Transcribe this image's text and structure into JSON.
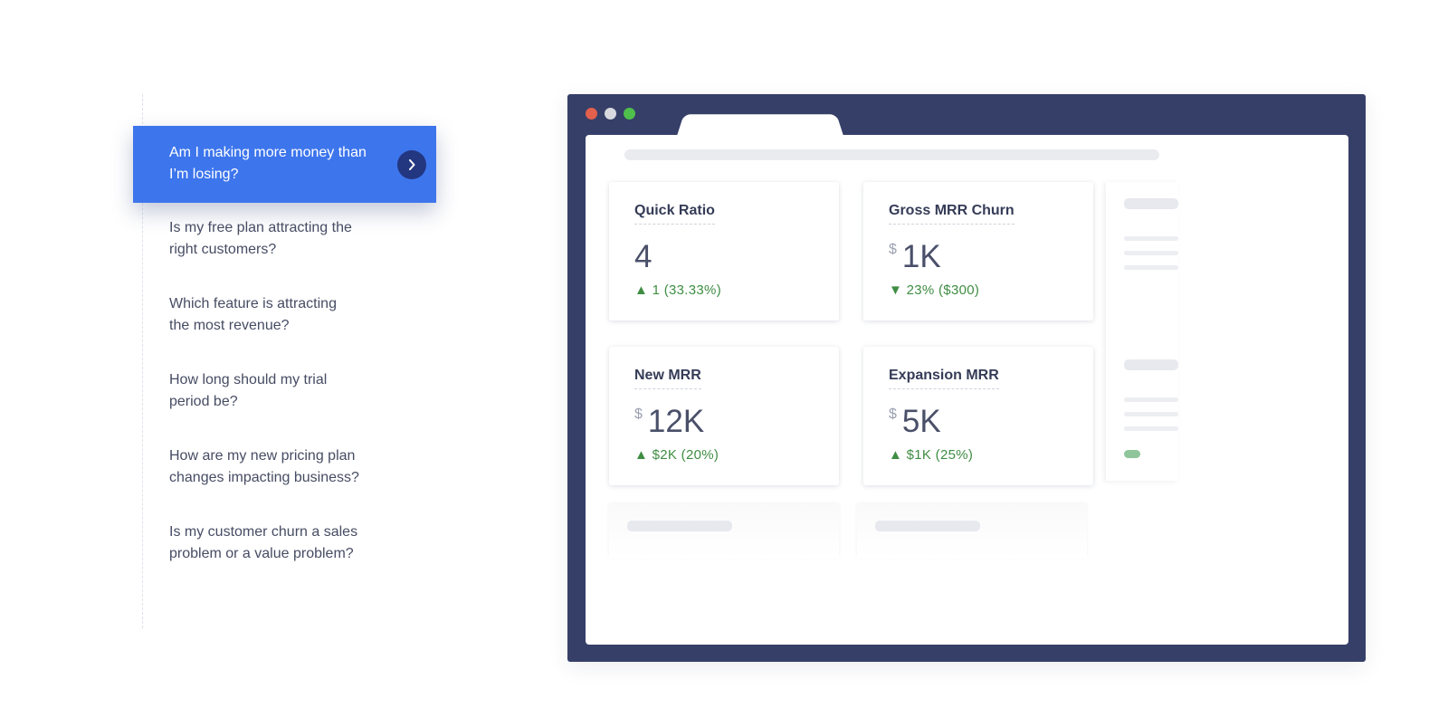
{
  "questions": {
    "active": "Am I making more money than I’m losing?",
    "items": [
      "Is my free plan attracting the right customers?",
      "Which feature is attracting the most revenue?",
      "How long should my trial period be?",
      "How are my new pricing plan changes impacting business?",
      "Is my customer churn a sales problem or a value problem?"
    ]
  },
  "dashboard": {
    "cards": [
      {
        "title": "Quick Ratio",
        "currency": "",
        "value": "4",
        "delta": "▲ 1 (33.33%)"
      },
      {
        "title": "Gross MRR Churn",
        "currency": "$",
        "value": "1K",
        "delta": "▼ 23% ($300)"
      },
      {
        "title": "New MRR",
        "currency": "$",
        "value": "12K",
        "delta": "▲ $2K (20%)"
      },
      {
        "title": "Expansion MRR",
        "currency": "$",
        "value": "5K",
        "delta": "▲ $1K (25%)"
      }
    ]
  },
  "colors": {
    "active_question_bg": "#3d75ec",
    "arrow_bg": "#233680",
    "browser_frame": "#363f68",
    "positive_delta": "#3f8d43"
  },
  "icons": {
    "arrow": "chevron-right-icon"
  }
}
